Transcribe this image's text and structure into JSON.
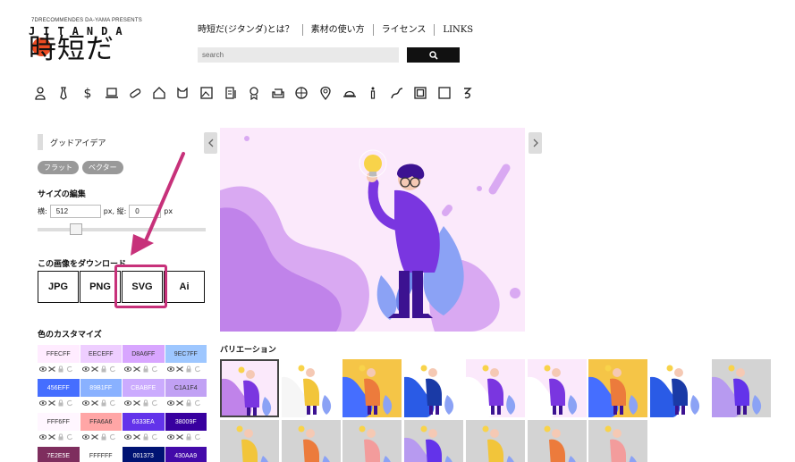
{
  "logo": {
    "tagline": "7DRECOMMENDES DA-YAMA PRESENTS",
    "brand": "JITANDA",
    "kanji": "時短だ"
  },
  "nav": {
    "items": [
      "時短だ(ジタンダ)とは？",
      "素材の使い方",
      "ライセンス",
      "LINKS"
    ]
  },
  "search": {
    "placeholder": "search",
    "button_icon": "search-icon"
  },
  "categories": [
    "person-icon",
    "tie-icon",
    "dollar-icon",
    "computer-icon",
    "pill-icon",
    "house-icon",
    "cat-icon",
    "picture-icon",
    "document-icon",
    "medal-icon",
    "sofa-icon",
    "basketball-icon",
    "map-pin-icon",
    "cap-icon",
    "info-icon",
    "route-icon",
    "frame-icon",
    "square-icon",
    "kana-icon"
  ],
  "sidebar": {
    "title": "グッドアイデア",
    "tags": [
      "フラット",
      "ベクター"
    ],
    "size_section": "サイズの編集",
    "width_label": "横:",
    "width_value": "512",
    "height_label": "px, 縦:",
    "height_value": "0",
    "unit_label": "px",
    "download_section": "この画像をダウンロード",
    "download_buttons": [
      "JPG",
      "PNG",
      "SVG",
      "Ai"
    ],
    "color_section": "色のカスタマイズ"
  },
  "palette": {
    "rows": [
      [
        {
          "hex": "FFECFF",
          "bg": "#FFECFF",
          "fg": "#333"
        },
        {
          "hex": "EECEFF",
          "bg": "#EECEFF",
          "fg": "#333"
        },
        {
          "hex": "D8A6FF",
          "bg": "#D8A6FF",
          "fg": "#333"
        },
        {
          "hex": "9EC7FF",
          "bg": "#9EC7FF",
          "fg": "#333"
        }
      ],
      [
        {
          "hex": "456EFF",
          "bg": "#456EFF",
          "fg": "#fff"
        },
        {
          "hex": "89B1FF",
          "bg": "#89B1FF",
          "fg": "#fff"
        },
        {
          "hex": "CBABFE",
          "bg": "#CBABFE",
          "fg": "#fff"
        },
        {
          "hex": "C1A1F4",
          "bg": "#C1A1F4",
          "fg": "#333"
        }
      ],
      [
        {
          "hex": "FFF6FF",
          "bg": "#FFF6FF",
          "fg": "#333"
        },
        {
          "hex": "FFA6A6",
          "bg": "#FFA6A6",
          "fg": "#333"
        },
        {
          "hex": "6333EA",
          "bg": "#6333EA",
          "fg": "#fff"
        },
        {
          "hex": "38009F",
          "bg": "#38009F",
          "fg": "#fff"
        }
      ],
      [
        {
          "hex": "7E2E5E",
          "bg": "#7E2E5E",
          "fg": "#fff"
        },
        {
          "hex": "FFFFFF",
          "bg": "#FFFFFF",
          "fg": "#333"
        },
        {
          "hex": "001373",
          "bg": "#001373",
          "fg": "#fff"
        },
        {
          "hex": "430AA9",
          "bg": "#430AA9",
          "fg": "#fff"
        }
      ]
    ]
  },
  "main": {
    "variation_title": "バリエーション",
    "accent_pink": "#c7317a"
  },
  "variations": [
    {
      "theme": "pink",
      "selected": true
    },
    {
      "theme": "white-yellow",
      "selected": false
    },
    {
      "theme": "yellow-blue",
      "selected": false
    },
    {
      "theme": "blue",
      "selected": false
    },
    {
      "theme": "pink-white",
      "selected": false
    },
    {
      "theme": "pink-white",
      "selected": false
    },
    {
      "theme": "yellow-blue",
      "selected": false
    },
    {
      "theme": "blue",
      "selected": false
    },
    {
      "theme": "gray-purple",
      "selected": false
    },
    {
      "theme": "gray-yellow",
      "selected": false
    },
    {
      "theme": "gray-orange",
      "selected": false
    },
    {
      "theme": "gray-pink",
      "selected": false
    },
    {
      "theme": "gray-purple",
      "selected": false
    },
    {
      "theme": "gray-yellow",
      "selected": false
    },
    {
      "theme": "gray-orange",
      "selected": false
    },
    {
      "theme": "gray-pink",
      "selected": false
    }
  ]
}
